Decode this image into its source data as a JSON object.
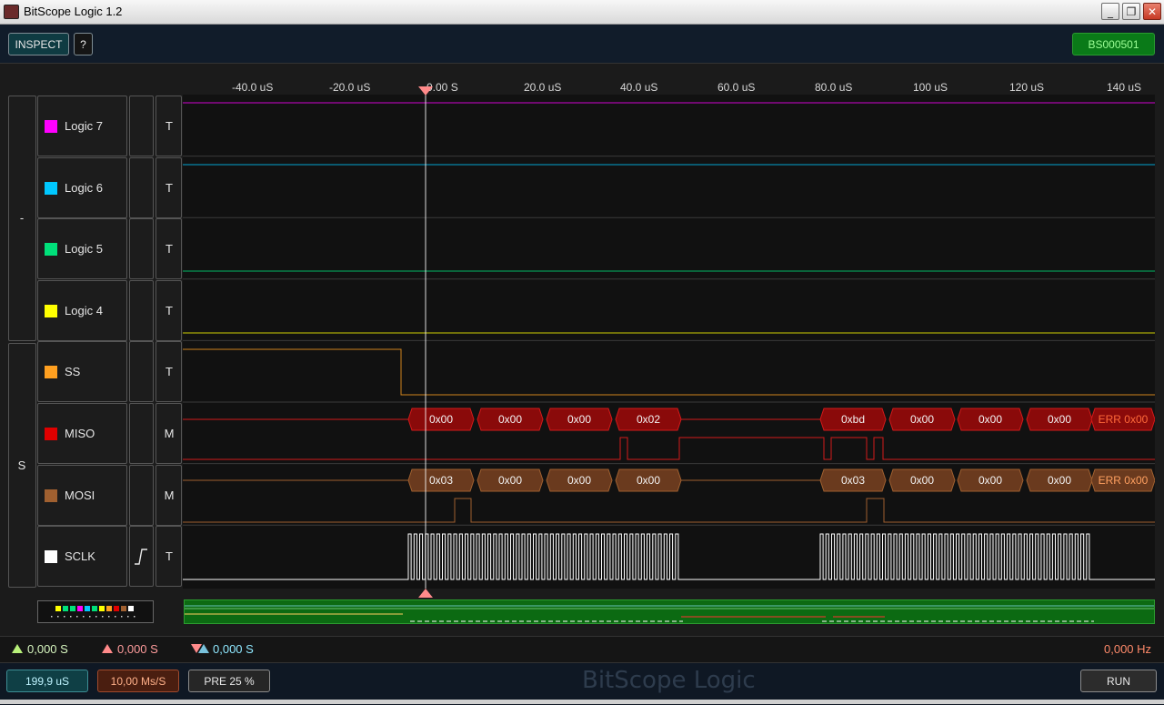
{
  "window": {
    "title": "BitScope Logic 1.2",
    "controls": {
      "minimize": "_",
      "maximize": "❐",
      "close": "✕"
    }
  },
  "toolbar": {
    "inspect_label": "INSPECT",
    "help_label": "?",
    "device_label": "BS000501"
  },
  "timeline": {
    "ticks": [
      "-40.0 uS",
      "-20.0 uS",
      "0.00  S",
      "20.0 uS",
      "40.0 uS",
      "60.0 uS",
      "80.0 uS",
      "100 uS",
      "120 uS",
      "140 uS"
    ]
  },
  "groups": [
    {
      "label": "-"
    },
    {
      "label": "S"
    }
  ],
  "channels": [
    {
      "name": "Logic 7",
      "color": "#ff00ff",
      "mode": "T"
    },
    {
      "name": "Logic 6",
      "color": "#00c8ff",
      "mode": "T"
    },
    {
      "name": "Logic 5",
      "color": "#00e07a",
      "mode": "T"
    },
    {
      "name": "Logic 4",
      "color": "#ffff00",
      "mode": "T"
    },
    {
      "name": "SS",
      "color": "#ffa020",
      "mode": "T"
    },
    {
      "name": "MISO",
      "color": "#e00000",
      "mode": "M"
    },
    {
      "name": "MOSI",
      "color": "#a06030",
      "mode": "M"
    },
    {
      "name": "SCLK",
      "color": "#ffffff",
      "mode": "T"
    }
  ],
  "decode": {
    "miso": [
      "0x00",
      "0x00",
      "0x00",
      "0x02",
      "0xbd",
      "0x00",
      "0x00",
      "0x00",
      "ERR 0x00"
    ],
    "mosi": [
      "0x03",
      "0x00",
      "0x00",
      "0x00",
      "0x03",
      "0x00",
      "0x00",
      "0x00",
      "ERR 0x00"
    ]
  },
  "status": {
    "cursor_a": "0,000  S",
    "cursor_b": "0,000  S",
    "cursor_delta": "0,000  S",
    "frequency": "0,000  Hz"
  },
  "bottom": {
    "duration": "199,9 uS",
    "sample_rate": "10,00 Ms/S",
    "pretrigger": "PRE 25 %",
    "run": "RUN",
    "brand": "BitScope Logic"
  },
  "colors": {
    "trace_bg": "#111111",
    "cursor": "#ff8a8a",
    "miso_box": "#8a0a0a",
    "mosi_box": "#6a3a1e",
    "overview": "#0c6a12"
  }
}
